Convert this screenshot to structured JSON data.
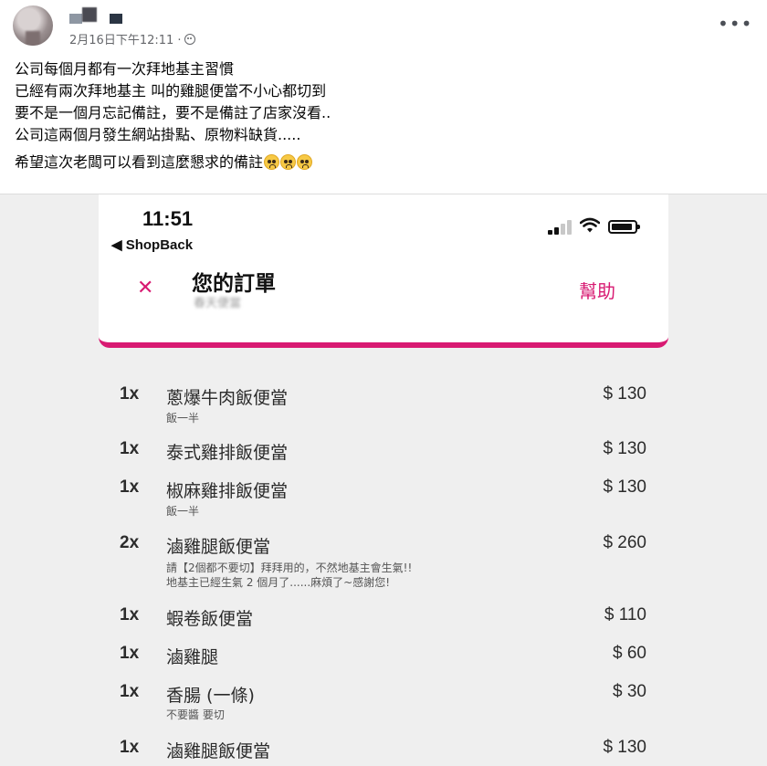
{
  "post": {
    "date": "2月16日下午12:11 ·",
    "audience_icon": "globe-icon",
    "more_icon": "more-options-icon",
    "lines": [
      "公司每個月都有一次拜地基主習慣",
      "已經有兩次拜地基主 叫的雞腿便當不小心都切到",
      "要不是一個月忘記備註，要不是備註了店家沒看..",
      "公司這兩個月發生網站掛點、原物料缺貨....."
    ],
    "closing_line": "希望這次老闆可以看到這麼懇求的備註",
    "emoji_icon": "pleading-face-emoji-icon"
  },
  "phone": {
    "time": "11:51",
    "back_app": "◀ ShopBack",
    "title": "您的訂單",
    "subtitle": "春天便當",
    "help": "幫助",
    "close_icon": "close-icon"
  },
  "order_items": [
    {
      "qty": "1x",
      "name": "蔥爆牛肉飯便當",
      "price": "$ 130",
      "note": [
        "飯一半"
      ]
    },
    {
      "qty": "1x",
      "name": "泰式雞排飯便當",
      "price": "$ 130",
      "note": []
    },
    {
      "qty": "1x",
      "name": "椒麻雞排飯便當",
      "price": "$ 130",
      "note": [
        "飯一半"
      ]
    },
    {
      "qty": "2x",
      "name": "滷雞腿飯便當",
      "price": "$ 260",
      "note": [
        "請【2個都不要切】拜拜用的，不然地基主會生氣!!",
        "地基主已經生氣 2 個月了......麻煩了~感謝您!"
      ]
    },
    {
      "qty": "1x",
      "name": "蝦卷飯便當",
      "price": "$ 110",
      "note": []
    },
    {
      "qty": "1x",
      "name": "滷雞腿",
      "price": "$ 60",
      "note": []
    },
    {
      "qty": "1x",
      "name": "香腸 (一條)",
      "price": "$ 30",
      "note": [
        "不要醬 要切"
      ]
    },
    {
      "qty": "1x",
      "name": "滷雞腿飯便當",
      "price": "$ 130",
      "note": []
    }
  ],
  "colors": {
    "accent": "#d81a72",
    "meta_text": "#65676b",
    "list_bg": "#efefef"
  }
}
